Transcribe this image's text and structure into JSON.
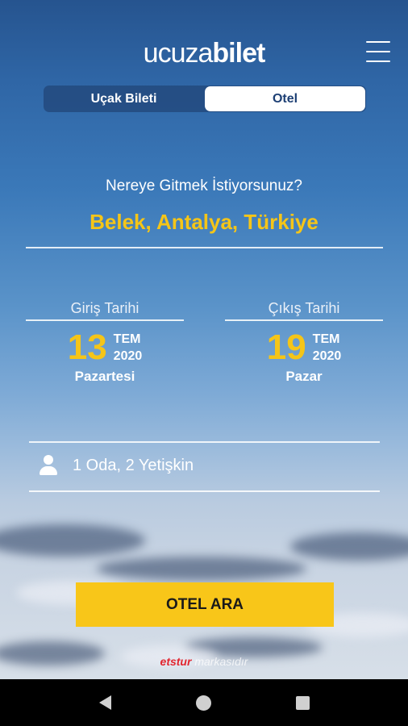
{
  "header": {
    "logo_thin": "ucuza",
    "logo_bold": "bilet"
  },
  "tabs": [
    {
      "label": "Uçak Bileti",
      "active": false
    },
    {
      "label": "Otel",
      "active": true
    }
  ],
  "search": {
    "question": "Nereye Gitmek İstiyorsunuz?",
    "destination": "Belek, Antalya, Türkiye"
  },
  "checkin": {
    "title": "Giriş Tarihi",
    "day": "13",
    "month": "TEM",
    "year": "2020",
    "weekday": "Pazartesi"
  },
  "checkout": {
    "title": "Çıkış Tarihi",
    "day": "19",
    "month": "TEM",
    "year": "2020",
    "weekday": "Pazar"
  },
  "guests": {
    "icon": "person-icon",
    "label": "1 Oda, 2 Yetişkin"
  },
  "search_button": {
    "label": "OTEL ARA",
    "color": "#f8c619"
  },
  "footer": {
    "brand": "etstur",
    "suffix": " markasıdır"
  },
  "colors": {
    "accent": "#f5c518",
    "brand_red": "#e2262f"
  }
}
